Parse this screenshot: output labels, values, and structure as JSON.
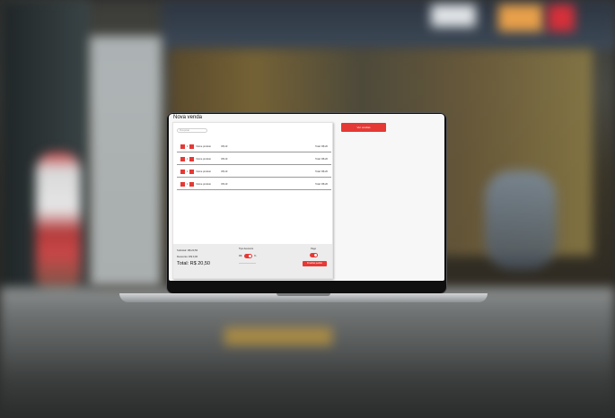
{
  "app": {
    "title": "Nova venda",
    "search_placeholder": "Pesquisar",
    "view_sales_label": "Ver vendas"
  },
  "cart": {
    "items": [
      {
        "minus": "-",
        "qty": "1",
        "plus": "+",
        "name": "Nome produto",
        "price": "R$ 10",
        "total": "Total: R$ 20"
      },
      {
        "minus": "-",
        "qty": "1",
        "plus": "+",
        "name": "Nome produto",
        "price": "R$ 10",
        "total": "Total: R$ 20"
      },
      {
        "minus": "-",
        "qty": "1",
        "plus": "+",
        "name": "Nome produto",
        "price": "R$ 10",
        "total": "Total: R$ 20"
      },
      {
        "minus": "-",
        "qty": "1",
        "plus": "+",
        "name": "Nome produto",
        "price": "R$ 10",
        "total": "Total: R$ 20"
      }
    ]
  },
  "summary": {
    "subtotal": "Subtotal: R$ 20,50",
    "desconto": "Desconto: R$ 0,00",
    "total": "Total: R$ 20,50",
    "tipo_desconto_label": "Tipo desconto",
    "currency_label": "R$",
    "percent_label": "%",
    "pago_label": "Pago",
    "finish_label": "Finalizar pedido"
  },
  "colors": {
    "accent": "#e53935"
  },
  "icons": {
    "minus": "minus-icon",
    "plus": "plus-icon"
  }
}
